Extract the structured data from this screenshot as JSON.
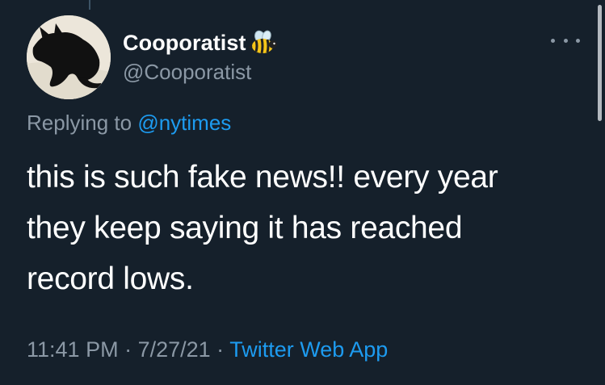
{
  "user": {
    "display_name": "Cooporatist",
    "handle": "@Cooporatist",
    "avatar_icon": "black-cat-photo",
    "badge_icon": "bee-emoji"
  },
  "reply": {
    "prefix": "Replying to ",
    "mention": "@nytimes"
  },
  "tweet": {
    "lines": [
      "this is such fake news!! every year",
      "they keep saying it has reached",
      "record lows."
    ]
  },
  "meta": {
    "time": "11:41 PM",
    "sep1": " · ",
    "date": "7/27/21",
    "sep2": " · ",
    "source": "Twitter Web App"
  },
  "colors": {
    "background": "#15202b",
    "text": "#ffffff",
    "secondary": "#8b98a5",
    "link": "#1d9bf0"
  }
}
